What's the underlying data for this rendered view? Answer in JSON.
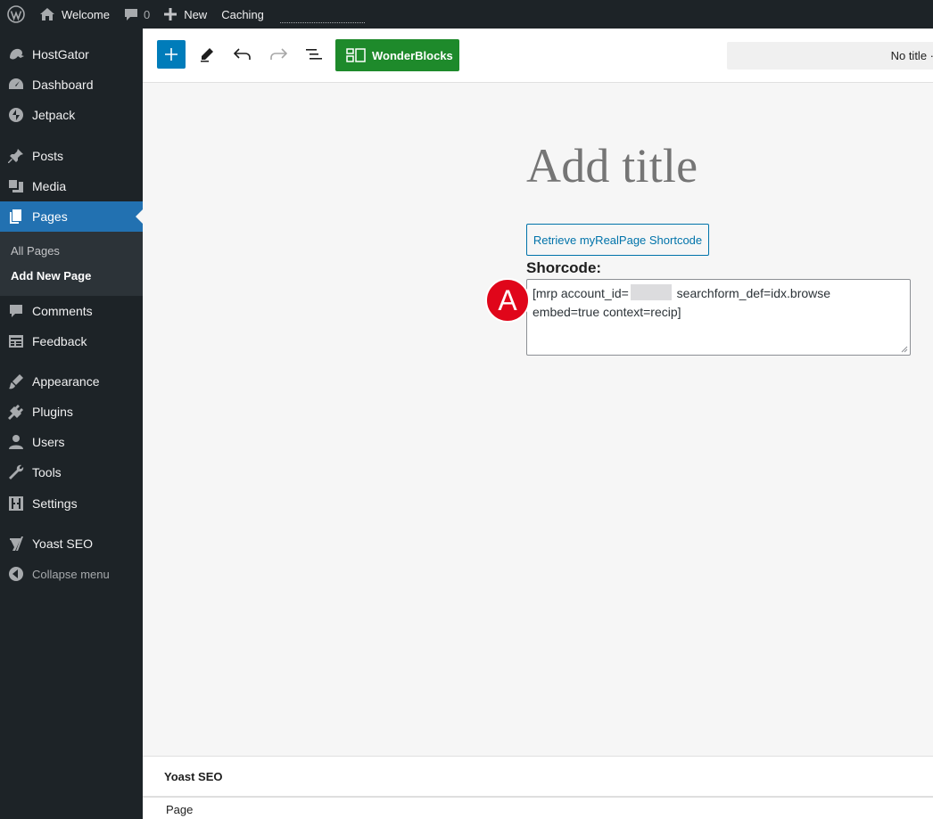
{
  "admin_bar": {
    "site_name": "Welcome",
    "comments_count": "0",
    "new_label": "New",
    "caching_label": "Caching"
  },
  "sidebar": {
    "items": [
      {
        "label": "HostGator",
        "icon": "hostgator-icon"
      },
      {
        "label": "Dashboard",
        "icon": "dashboard-icon"
      },
      {
        "label": "Jetpack",
        "icon": "jetpack-icon"
      },
      {
        "label": "Posts",
        "icon": "pin-icon"
      },
      {
        "label": "Media",
        "icon": "media-icon"
      },
      {
        "label": "Pages",
        "icon": "pages-icon",
        "current": true
      },
      {
        "label": "Comments",
        "icon": "comment-icon"
      },
      {
        "label": "Feedback",
        "icon": "feedback-icon"
      },
      {
        "label": "Appearance",
        "icon": "brush-icon"
      },
      {
        "label": "Plugins",
        "icon": "plug-icon"
      },
      {
        "label": "Users",
        "icon": "user-icon"
      },
      {
        "label": "Tools",
        "icon": "wrench-icon"
      },
      {
        "label": "Settings",
        "icon": "settings-icon"
      },
      {
        "label": "Yoast SEO",
        "icon": "yoast-icon"
      }
    ],
    "submenu": [
      "All Pages",
      "Add New Page"
    ],
    "collapse_label": "Collapse menu"
  },
  "toolbar": {
    "wonderblocks_label": "WonderBlocks",
    "document_title": "No title ·"
  },
  "editor": {
    "title_placeholder": "Add title",
    "retrieve_button": "Retrieve myRealPage Shortcode",
    "shortcode_label": "Shorcode:",
    "shortcode_part1": "[mrp account_id=",
    "shortcode_part2": " searchform_def=idx.browse",
    "shortcode_line2": "embed=true context=recip]",
    "annotation_badge": "A"
  },
  "metabox": {
    "yoast_title": "Yoast SEO"
  },
  "footer": {
    "breadcrumb": "Page"
  },
  "colors": {
    "admin_bg": "#1d2327",
    "accent": "#2271b1",
    "wonderblocks_green": "#1e8a2b",
    "annotation_red": "#e0061a"
  }
}
